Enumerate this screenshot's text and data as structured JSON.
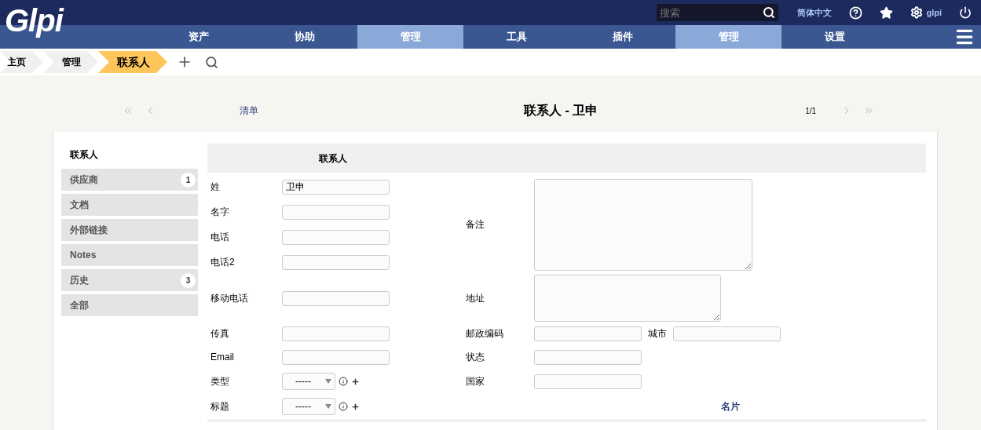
{
  "header": {
    "logo": "Glpi",
    "search": {
      "placeholder": "搜索"
    },
    "language": "简体中文",
    "user": "glpi"
  },
  "menu": [
    {
      "label": "资产",
      "selected": false
    },
    {
      "label": "协助",
      "selected": false
    },
    {
      "label": "管理",
      "selected": true
    },
    {
      "label": "工具",
      "selected": false
    },
    {
      "label": "插件",
      "selected": false
    },
    {
      "label": "管理",
      "selected": true
    },
    {
      "label": "设置",
      "selected": false
    }
  ],
  "breadcrumbs": [
    {
      "label": "主页",
      "selected": false
    },
    {
      "label": "管理",
      "selected": false
    },
    {
      "label": "联系人",
      "selected": true
    }
  ],
  "navigation": {
    "list_link": "清单",
    "title": "联系人 - 卫申",
    "counter": "1/1"
  },
  "tabs": [
    {
      "label": "联系人",
      "selected": true
    },
    {
      "label": "供应商",
      "count": "1",
      "selected": false
    },
    {
      "label": "文档",
      "selected": false
    },
    {
      "label": "外部链接",
      "selected": false
    },
    {
      "label": "Notes",
      "selected": false
    },
    {
      "label": "历史",
      "count": "3",
      "selected": false
    },
    {
      "label": "全部",
      "selected": false
    }
  ],
  "form": {
    "header": "联系人",
    "left_fields": [
      {
        "label": "姓",
        "kind": "text",
        "value": "卫申"
      },
      {
        "label": "名字",
        "kind": "text"
      },
      {
        "label": "电话",
        "kind": "text"
      },
      {
        "label": "电话2",
        "kind": "text"
      },
      {
        "label": "移动电话",
        "kind": "text"
      },
      {
        "label": "传真",
        "kind": "text"
      },
      {
        "label": "Email",
        "kind": "text"
      },
      {
        "label": "类型",
        "kind": "select",
        "value": "-----"
      },
      {
        "label": "标题",
        "kind": "select",
        "value": "-----"
      }
    ],
    "right_fields": [
      {
        "label": "备注",
        "kind": "textarea"
      },
      {
        "label": "地址",
        "kind": "textarea"
      },
      {
        "label": "邮政编码",
        "kind": "text",
        "extra_label": "城市"
      },
      {
        "label": "状态",
        "kind": "text"
      },
      {
        "label": "国家",
        "kind": "text"
      }
    ],
    "vcard_link": "名片"
  }
}
